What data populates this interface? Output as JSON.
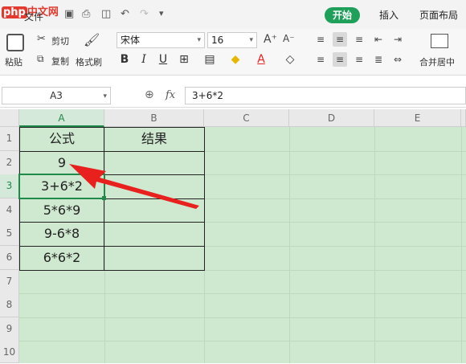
{
  "titlebar": {
    "logo_php": "php",
    "logo_cn": "中文网",
    "file_menu": "文件",
    "tabs": [
      {
        "label": "开始",
        "active": true
      },
      {
        "label": "插入",
        "active": false
      },
      {
        "label": "页面布局",
        "active": false
      }
    ]
  },
  "ribbon": {
    "paste_label": "粘贴",
    "cut_label": "剪切",
    "copy_label": "复制",
    "format_painter_label": "格式刷",
    "font_name": "宋体",
    "font_size": "16",
    "merge_center_label": "合并居中"
  },
  "formula_bar": {
    "name_box": "A3",
    "fx": "fx",
    "formula": "3+6*2"
  },
  "sheet": {
    "columns": [
      "A",
      "B",
      "C",
      "D",
      "E"
    ],
    "rows": [
      "1",
      "2",
      "3",
      "4",
      "5",
      "6",
      "7",
      "8",
      "9",
      "10"
    ],
    "cells": {
      "A1": "公式",
      "B1": "结果",
      "A2": "9",
      "A3": "3+6*2",
      "A4": "5*6*9",
      "A5": "9-6*8",
      "A6": "6*6*2"
    }
  },
  "colors": {
    "accent": "#1fa05a",
    "sheet_bg": "#cfe8d0",
    "arrow": "#e8201e"
  }
}
